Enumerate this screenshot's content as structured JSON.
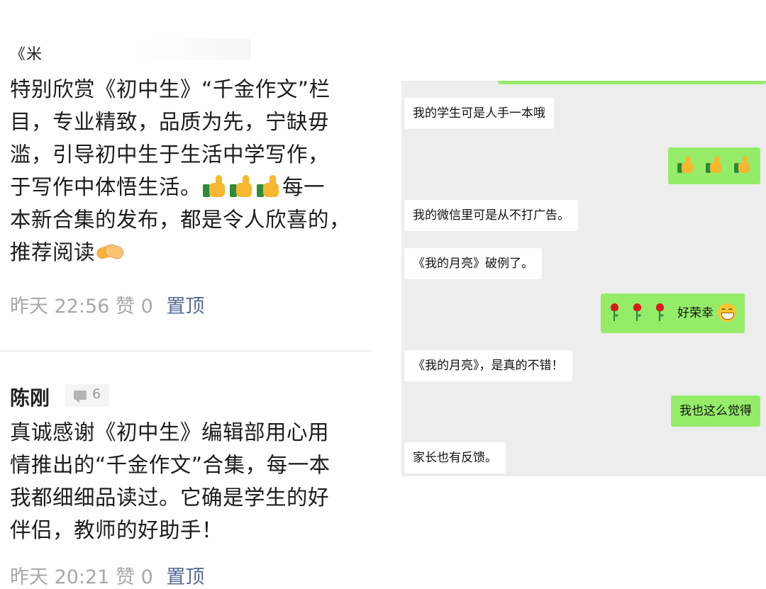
{
  "comments": {
    "first": {
      "author_partial": "《米",
      "text_lines": [
        "特别欣赏《初中生》“千金作文”栏",
        "目，专业精致，品质为先，宁缺毋",
        "滥，引导初中生于生活中学写作，",
        "于写作中体悟生活。",
        "本新合集的发布，都是令人欣喜的，",
        "推荐阅读"
      ],
      "line4_tail": "每一",
      "time": "昨天 22:56",
      "likes": "赞 0",
      "pin": "置顶"
    },
    "second": {
      "author": "陈刚",
      "reply_count": "6",
      "text_lines": [
        "真诚感谢《初中生》编辑部用心用",
        "情推出的“千金作文”合集，每一本",
        "我都细细品读过。它确是学生的好",
        "伴侣，教师的好助手！"
      ],
      "time": "昨天 20:21",
      "likes": "赞 0",
      "pin": "置顶"
    }
  },
  "chat": {
    "messages": [
      {
        "side": "in",
        "text": "我的学生可是人手一本哦"
      },
      {
        "side": "out",
        "text": "",
        "icons": "thumbs-up x3"
      },
      {
        "side": "in",
        "text": "我的微信里可是从不打广告。"
      },
      {
        "side": "in",
        "text": "《我的月亮》破例了。"
      },
      {
        "side": "out",
        "text": "好荣幸",
        "icons": "rose x3, grin"
      },
      {
        "side": "in",
        "text": "《我的月亮》，是真的不错！"
      },
      {
        "side": "out",
        "text": "我也这么觉得"
      },
      {
        "side": "in",
        "text": "家长也有反馈。"
      }
    ]
  },
  "colors": {
    "link_blue": "#576b95",
    "meta_gray": "#a8a8a8",
    "chat_bg": "#ededed",
    "bubble_out": "#95ec69",
    "bubble_in": "#ffffff"
  }
}
